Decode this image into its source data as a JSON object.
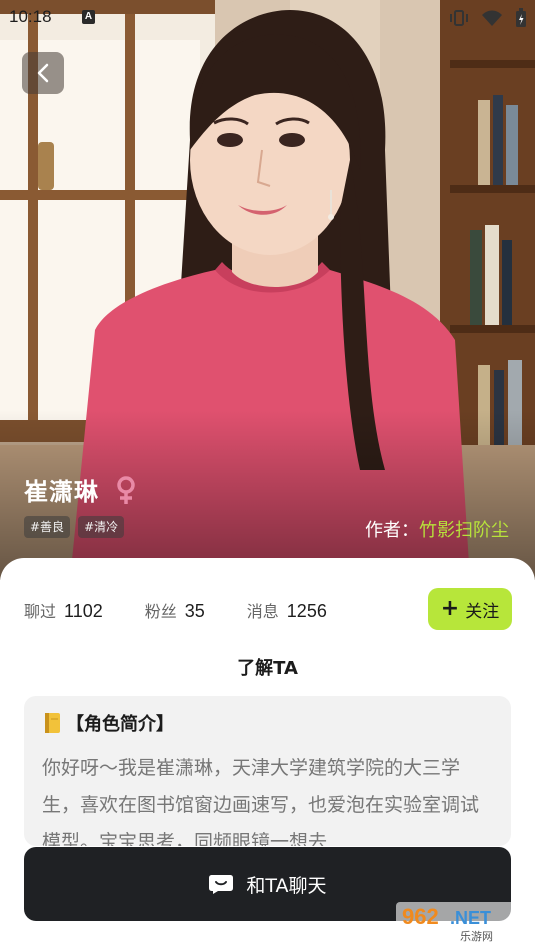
{
  "status_bar": {
    "time": "10:18",
    "icons": [
      "text-a-icon",
      "vibrate-icon",
      "wifi-icon",
      "battery-icon"
    ]
  },
  "hero": {
    "image": "portrait of woman in pink sweater by a window and bookshelf",
    "back_icon": "chevron-left-icon"
  },
  "character": {
    "name": "崔潇琳",
    "gender_icon": "female-icon",
    "tags": [
      "#善良",
      "#清冷"
    ],
    "author_label": "作者：",
    "author_name": "竹影扫阶尘"
  },
  "stats": [
    {
      "label": "聊过",
      "value": "1102"
    },
    {
      "label": "粉丝",
      "value": "35"
    },
    {
      "label": "消息",
      "value": "1256"
    }
  ],
  "follow_button": {
    "icon": "plus-icon",
    "label": "关注"
  },
  "section_title": "了解TA",
  "intro": {
    "icon": "notebook-icon",
    "title": "【角色简介】",
    "text": "你好呀～我是崔潇琳，天津大学建筑学院的大三学生，喜欢在图书馆窗边画速写，也爱泡在实验室调试模型。宝宝思考，同频眼镜一想去"
  },
  "chat_button": {
    "icon": "chat-bubble-icon",
    "label": "和TA聊天"
  },
  "watermark": {
    "brand": "962.NET",
    "subtitle": "乐游网"
  },
  "colors": {
    "accent_green": "#b7e63a",
    "author_green": "#b7e23b",
    "chat_button_bg": "#1f2124",
    "gender_pink": "#e98aa6"
  }
}
